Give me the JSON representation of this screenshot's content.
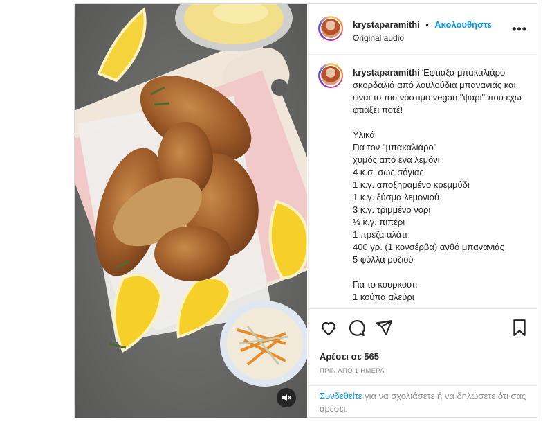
{
  "header": {
    "username": "krystaparamithi",
    "separator": "•",
    "follow_label": "Ακολουθήστε",
    "audio": "Original audio",
    "more_icon": "more-options-icon"
  },
  "caption": {
    "username": "krystaparamithi",
    "text": "Έφτιαξα μπακαλιάρο σκορδαλιά από λουλούδια μπανανιάς και είναι το πιο νόστιμο vegan \"ψάρι\" που έχω φτιάξει ποτέ!\n\nΥλικά\nΓια τον \"μπακαλιάρο\"\nχυμός από ένα λεμόνι\n4 κ.σ. σως σόγιας\n1 κ.γ. αποξηραμένο κρεμμύδι\n1 κ.γ. ξύσμα λεμονιού\n3 κ.γ. τριμμένο νόρι\n⅓ κ.γ. πιπέρι\n1 πρέζα αλάτι\n400 γρ. (1 κονσέρβα) ανθό μπανανιάς\n5 φύλλα ρυζιού\n\nΓια το κουρκούτι\n1 κούπα αλεύρι"
  },
  "actions": {
    "icons": [
      "heart-icon",
      "comment-icon",
      "share-icon",
      "bookmark-icon"
    ],
    "likes": "Αρέσει σε 565",
    "timestamp": "ΠΡΙΝ ΑΠΟ 1 ΗΜΕΡΑ"
  },
  "login_prompt": {
    "link": "Συνδεθείτε",
    "text": " για να σχολιάσετε ή να δηλώσετε ότι σας αρέσει."
  },
  "media": {
    "mute_icon": "speaker-muted-icon"
  },
  "colors": {
    "accent": "#0095f6",
    "border": "#dbdbdb",
    "muted": "#8e8e8e"
  }
}
